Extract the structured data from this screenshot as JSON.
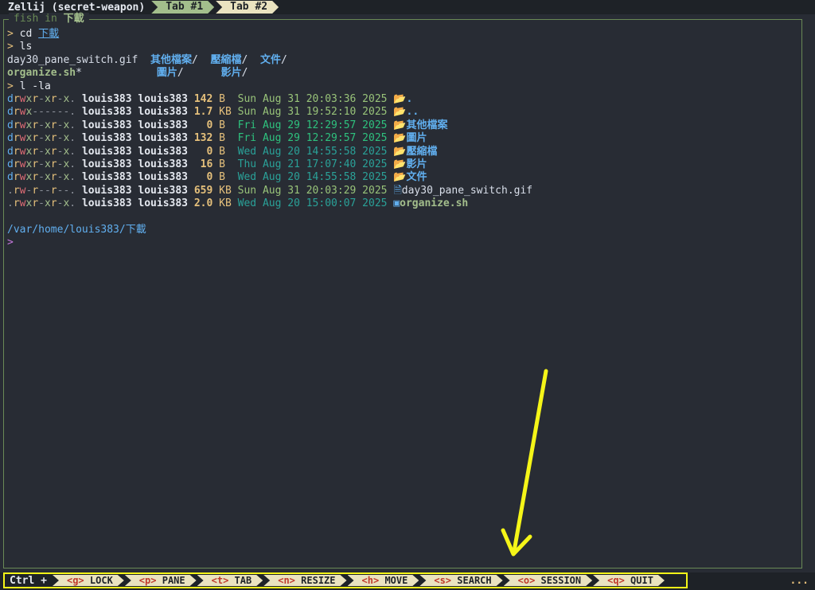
{
  "topbar": {
    "title": "Zellij (secret-weapon)",
    "tabs": [
      {
        "label": "Tab #1",
        "active": true
      },
      {
        "label": "Tab #2",
        "active": false
      }
    ]
  },
  "pane": {
    "title_shell": "fish in",
    "title_dir": "下載"
  },
  "terminal": {
    "prompt": ">",
    "cmd1": "cd",
    "cmd1_arg": "下載",
    "cmd2": "ls",
    "ls_row1": {
      "a": "day30_pane_switch.gif",
      "b": "其他檔案",
      "c": "壓縮檔",
      "d": "文件"
    },
    "ls_row2": {
      "a": "organize.sh",
      "a_suffix": "*",
      "b": "圖片",
      "c": "影片"
    },
    "slash": "/",
    "cmd3": "l -la",
    "listing": [
      {
        "perm": "drwxr-xr-x.",
        "user": "louis383",
        "group": "louis383",
        "size": "142",
        "unit": "B",
        "date": "Sun Aug 31 20:03:36 2025",
        "age": "new",
        "icon": "folder-icon",
        "name": ".",
        "kind": "dir"
      },
      {
        "perm": "drwx------.",
        "user": "louis383",
        "group": "louis383",
        "size": "1.7",
        "unit": "KB",
        "date": "Sun Aug 31 19:52:10 2025",
        "age": "new",
        "icon": "folder-icon",
        "name": "..",
        "kind": "dir"
      },
      {
        "perm": "drwxr-xr-x.",
        "user": "louis383",
        "group": "louis383",
        "size": "  0",
        "unit": "B",
        "date": "Fri Aug 29 12:29:57 2025",
        "age": "mid",
        "icon": "folder-icon",
        "name": "其他檔案",
        "kind": "dir"
      },
      {
        "perm": "drwxr-xr-x.",
        "user": "louis383",
        "group": "louis383",
        "size": "132",
        "unit": "B",
        "date": "Fri Aug 29 12:29:57 2025",
        "age": "mid",
        "icon": "folder-icon",
        "name": "圖片",
        "kind": "dir"
      },
      {
        "perm": "drwxr-xr-x.",
        "user": "louis383",
        "group": "louis383",
        "size": "  0",
        "unit": "B",
        "date": "Wed Aug 20 14:55:58 2025",
        "age": "old",
        "icon": "folder-icon",
        "name": "壓縮檔",
        "kind": "dir"
      },
      {
        "perm": "drwxr-xr-x.",
        "user": "louis383",
        "group": "louis383",
        "size": " 16",
        "unit": "B",
        "date": "Thu Aug 21 17:07:40 2025",
        "age": "old",
        "icon": "folder-icon",
        "name": "影片",
        "kind": "dir"
      },
      {
        "perm": "drwxr-xr-x.",
        "user": "louis383",
        "group": "louis383",
        "size": "  0",
        "unit": "B",
        "date": "Wed Aug 20 14:55:58 2025",
        "age": "old",
        "icon": "folder-icon",
        "name": "文件",
        "kind": "dir"
      },
      {
        "perm": ".rw-r--r--.",
        "user": "louis383",
        "group": "louis383",
        "size": "659",
        "unit": "KB",
        "date": "Sun Aug 31 20:03:29 2025",
        "age": "new",
        "icon": "file-icon",
        "name": "day30_pane_switch.gif",
        "kind": "file"
      },
      {
        "perm": ".rwxr-xr-x.",
        "user": "louis383",
        "group": "louis383",
        "size": "2.0",
        "unit": "KB",
        "date": "Wed Aug 20 15:00:07 2025",
        "age": "old",
        "icon": "terminal-icon",
        "name": "organize.sh",
        "kind": "exe"
      }
    ],
    "cwd": "/var/home/louis383/下載",
    "next_prompt": ">"
  },
  "statusbar": {
    "ctrl_label": "Ctrl +",
    "hints": [
      {
        "key": "<g>",
        "label": "LOCK"
      },
      {
        "key": "<p>",
        "label": "PANE"
      },
      {
        "key": "<t>",
        "label": "TAB"
      },
      {
        "key": "<n>",
        "label": "RESIZE"
      },
      {
        "key": "<h>",
        "label": "MOVE"
      },
      {
        "key": "<s>",
        "label": "SEARCH"
      },
      {
        "key": "<o>",
        "label": "SESSION"
      },
      {
        "key": "<q>",
        "label": "QUIT"
      }
    ],
    "more": "..."
  },
  "colors": {
    "highlight": "#f5f518",
    "accent": "#a3be8c"
  }
}
